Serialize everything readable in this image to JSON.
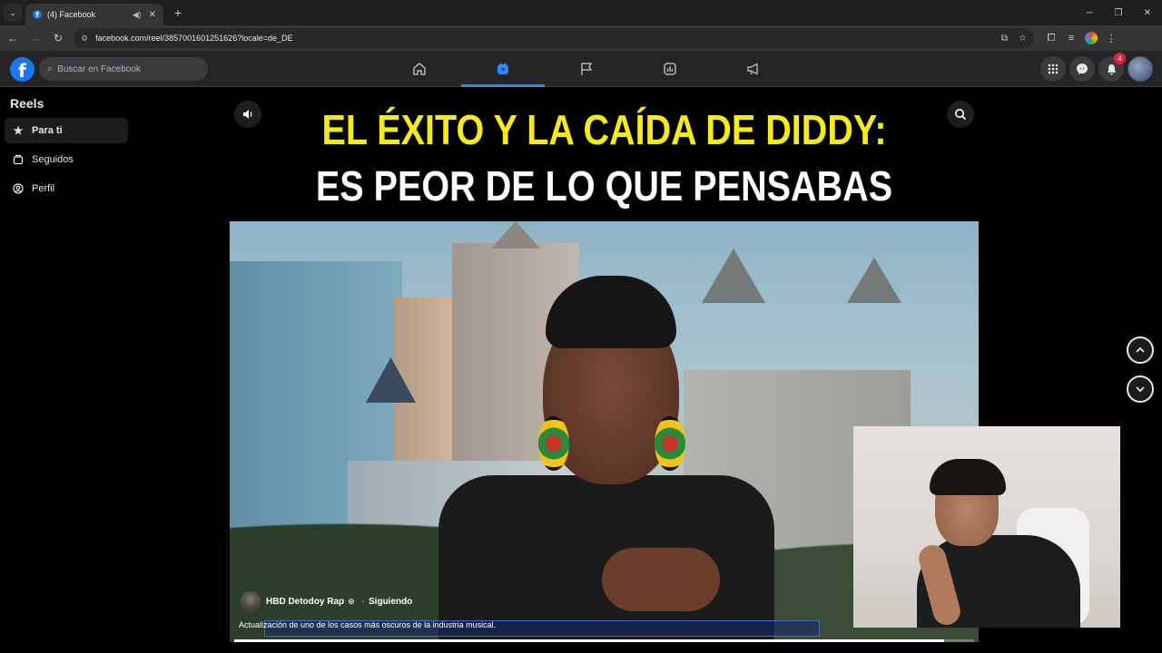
{
  "browser": {
    "tab_title": "(4) Facebook",
    "url": "facebook.com/reel/3857001601251626?locale=de_DE"
  },
  "facebook": {
    "search_placeholder": "Buscar en Facebook",
    "notification_count": "4",
    "nav": [
      "home",
      "reels",
      "pages",
      "marketplace",
      "ads"
    ],
    "active_nav": "reels"
  },
  "sidebar": {
    "title": "Reels",
    "items": [
      {
        "label": "Para ti",
        "icon": "star-icon",
        "active": true
      },
      {
        "label": "Seguidos",
        "icon": "following-icon",
        "active": false
      },
      {
        "label": "Perfil",
        "icon": "profile-icon",
        "active": false
      }
    ]
  },
  "reel": {
    "title_line1": "EL ÉXITO Y LA CAÍDA DE DIDDY:",
    "title_line2": "ES PEOR DE LO QUE PENSABAS",
    "author": "HBD Detodoy Rap",
    "follow_state": "Siguiendo",
    "caption": "Actualización de uno de los casos más oscuros de la industria musical.",
    "progress": 0.96
  },
  "colors": {
    "facebook_blue": "#1877f2",
    "active_nav": "#2d88ff",
    "title_yellow": "#f5ea1a",
    "badge_red": "#e41e3f"
  }
}
